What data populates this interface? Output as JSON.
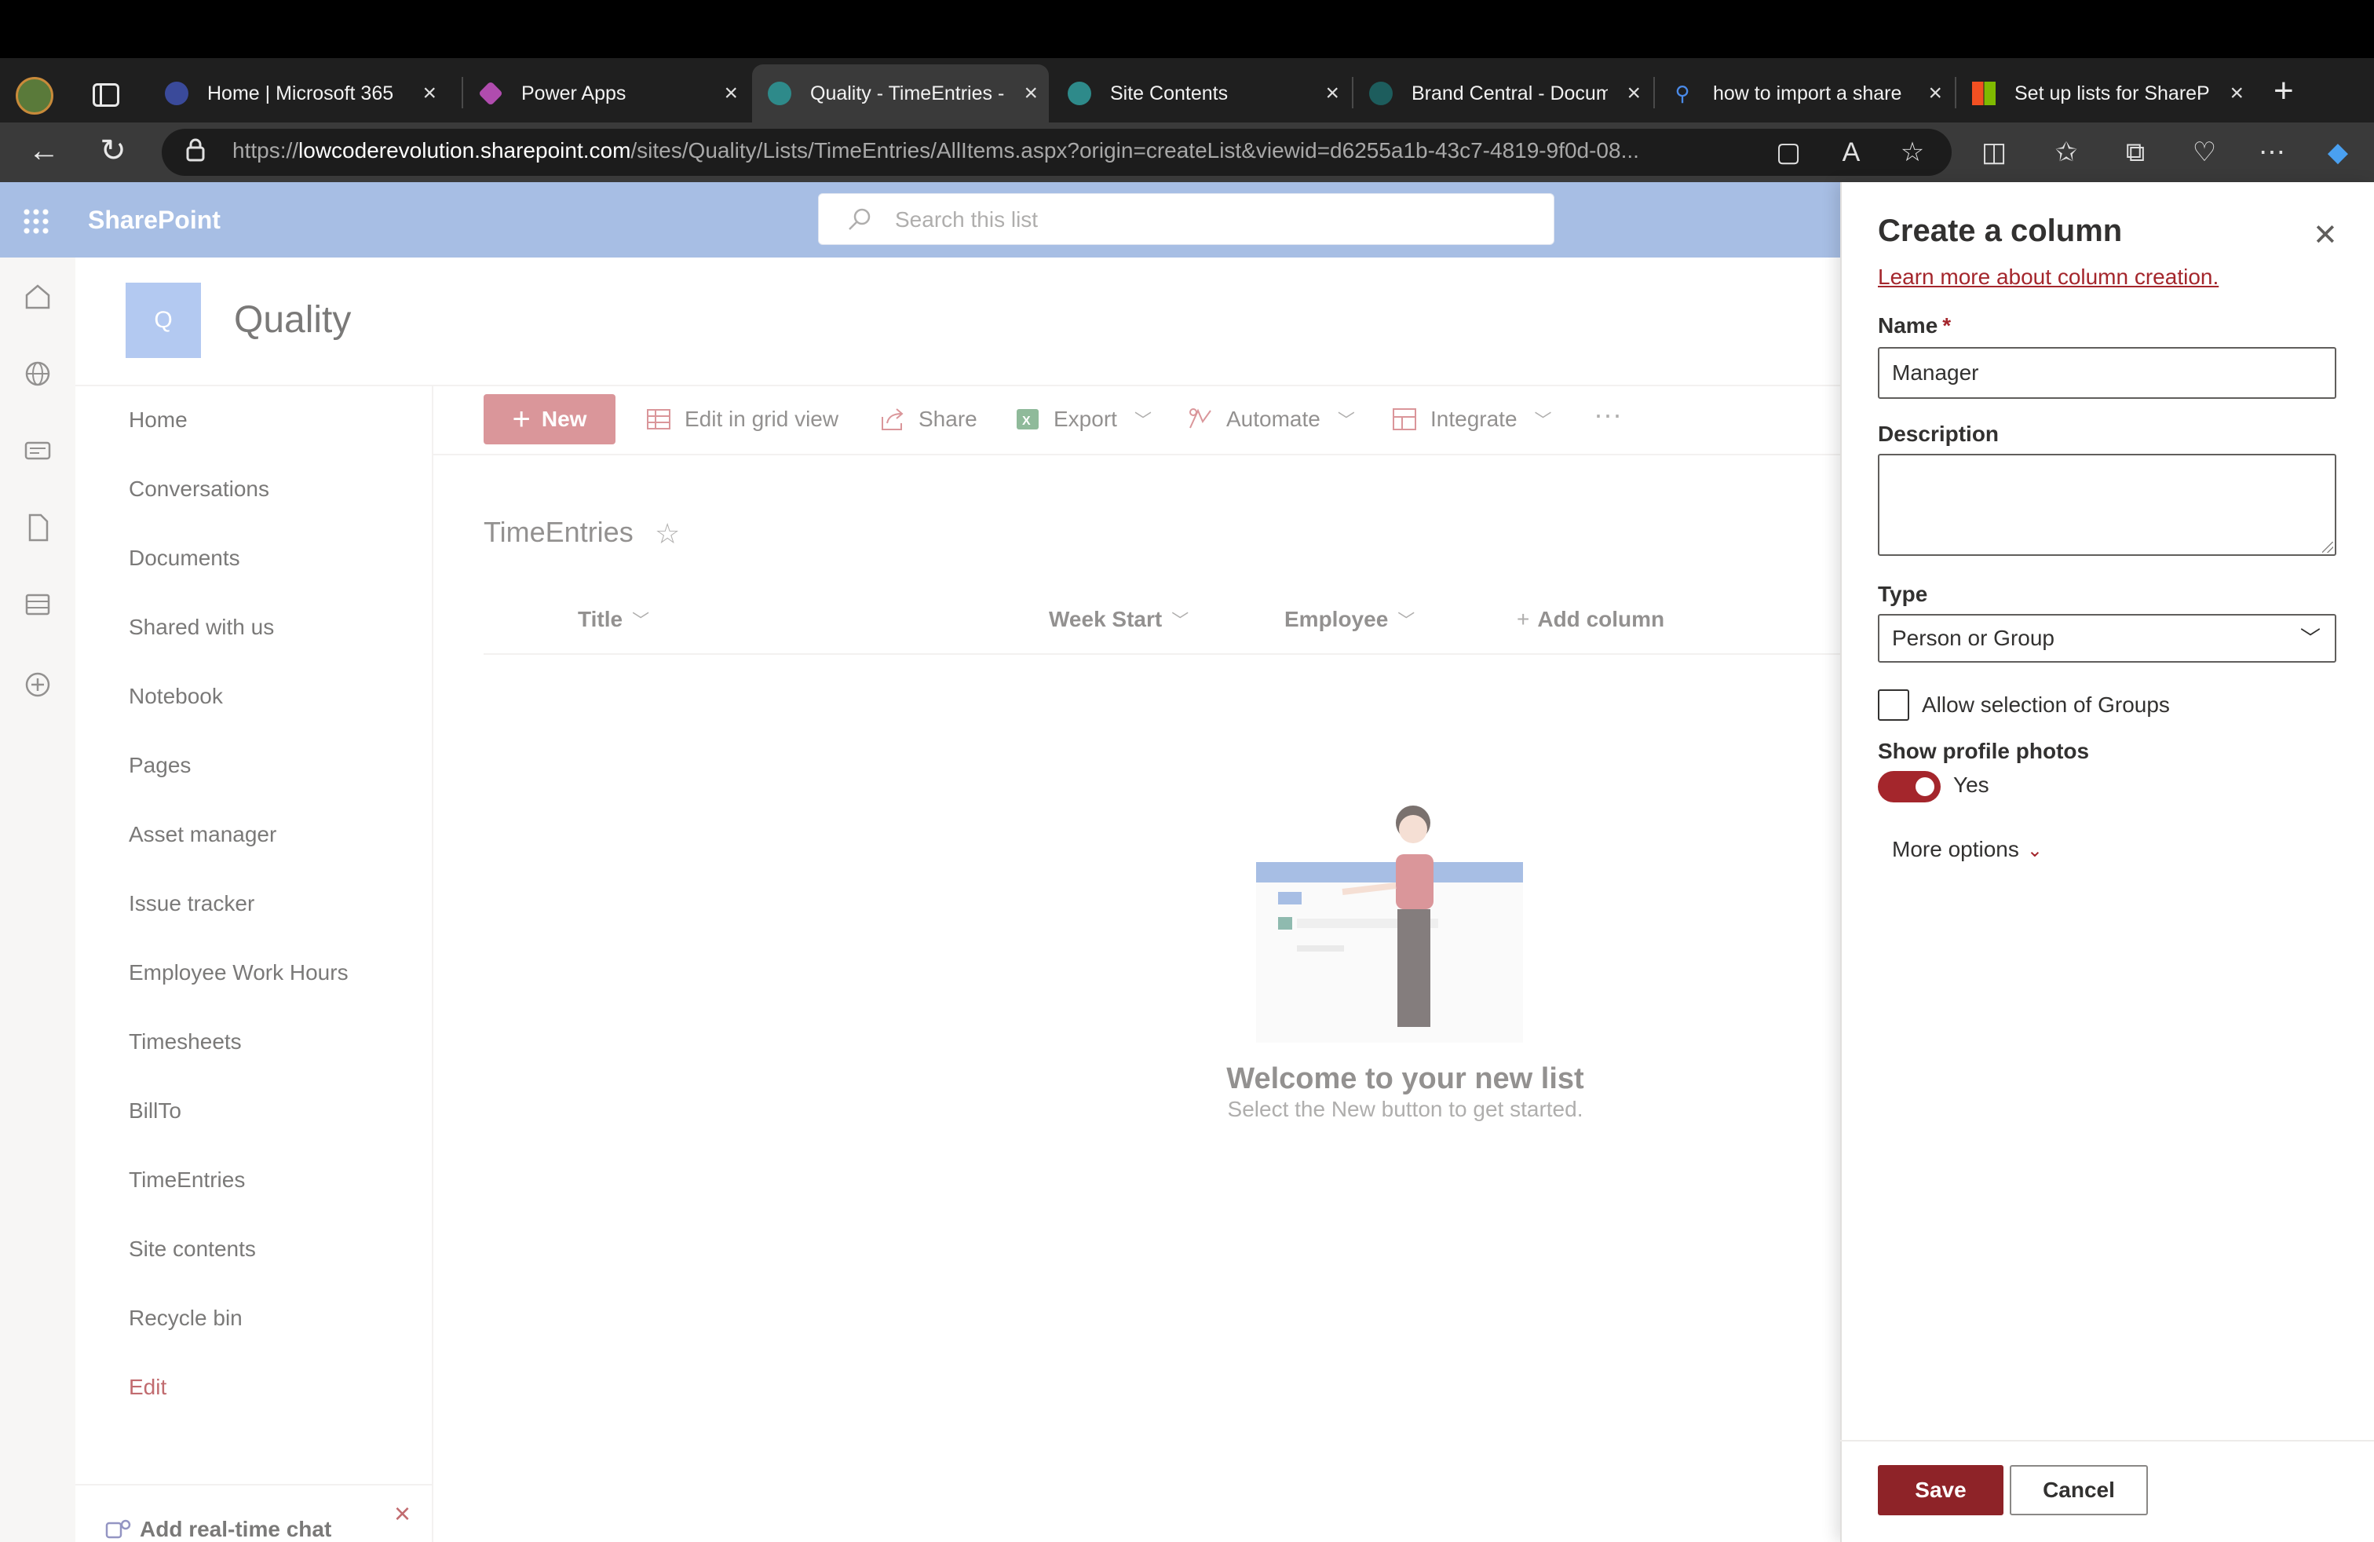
{
  "browser": {
    "tabs": [
      {
        "title": "Home | Microsoft 365",
        "icon": "m365-icon"
      },
      {
        "title": "Power Apps",
        "icon": "powerapps-icon"
      },
      {
        "title": "Quality - TimeEntries -",
        "icon": "sharepoint-icon",
        "active": true
      },
      {
        "title": "Site Contents",
        "icon": "sharepoint-icon"
      },
      {
        "title": "Brand Central - Docum",
        "icon": "sharepoint-icon"
      },
      {
        "title": "how to import a share",
        "icon": "search-icon"
      },
      {
        "title": "Set up lists for ShareP",
        "icon": "microsoft-icon"
      }
    ],
    "url_prefix": "https://",
    "url_domain": "lowcoderevolution.sharepoint.com",
    "url_path": "/sites/Quality/Lists/TimeEntries/AllItems.aspx?origin=createList&viewid=d6255a1b-43c7-4819-9f0d-08..."
  },
  "suite": {
    "app_name": "SharePoint",
    "search_placeholder": "Search this list"
  },
  "site": {
    "logo_letter": "Q",
    "title": "Quality"
  },
  "leftnav": {
    "items": [
      "Home",
      "Conversations",
      "Documents",
      "Shared with us",
      "Notebook",
      "Pages",
      "Asset manager",
      "Issue tracker",
      "Employee Work Hours",
      "Timesheets",
      "BillTo",
      "TimeEntries",
      "Site contents",
      "Recycle bin"
    ],
    "edit": "Edit",
    "chat": "Add real-time chat"
  },
  "commandbar": {
    "new": "New",
    "edit_grid": "Edit in grid view",
    "share": "Share",
    "export": "Export",
    "automate": "Automate",
    "integrate": "Integrate",
    "more": "···"
  },
  "list": {
    "title": "TimeEntries",
    "columns": [
      "Title",
      "Week Start",
      "Employee"
    ],
    "add_column": "Add column",
    "welcome": "Welcome to your new list",
    "welcome_sub": "Select the New button to get started."
  },
  "panel": {
    "title": "Create a column",
    "learn_more": "Learn more about column creation.",
    "name_label": "Name",
    "required_mark": "*",
    "name_value": "Manager",
    "description_label": "Description",
    "description_value": "",
    "type_label": "Type",
    "type_value": "Person or Group",
    "allow_groups_label": "Allow selection of Groups",
    "allow_groups_checked": false,
    "profile_photos_label": "Show profile photos",
    "profile_photos_on": true,
    "profile_photos_value": "Yes",
    "more_options": "More options",
    "save": "Save",
    "cancel": "Cancel"
  },
  "colors": {
    "accent": "#a4262c",
    "save_button": "#8e2328",
    "suite_bar": "#7ea0d8",
    "new_button": "#c9656b"
  }
}
